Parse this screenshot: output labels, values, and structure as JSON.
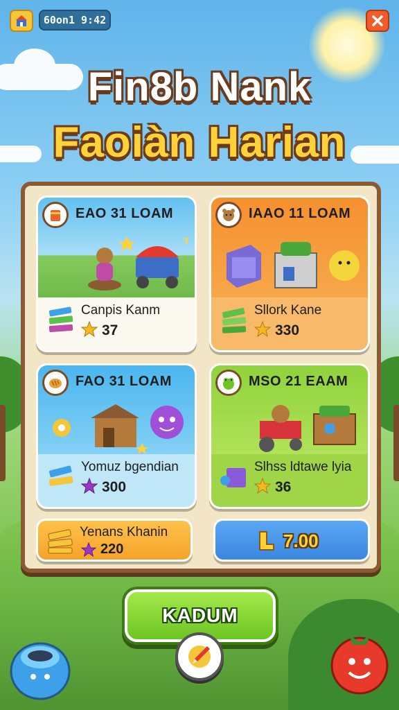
{
  "header": {
    "time": "60on1 9:42",
    "close_icon": "close-icon",
    "menu_icon": "house-icon"
  },
  "title": {
    "line1": "Fin8b Nank",
    "line2": "Faoiàn Harian"
  },
  "cards": [
    {
      "head": "EAO 31 LOAM",
      "name": "Canpis Kanm",
      "value": "37",
      "star_color": "#f5b820"
    },
    {
      "head": "IAAO 11 LOAM",
      "name": "Sllork Kane",
      "value": "330",
      "star_color": "#f5b820"
    },
    {
      "head": "FAO 31 LOAM",
      "name": "Yomuz bgendian",
      "value": "300",
      "star_color": "#9a38c8"
    },
    {
      "head": "MSO 21 EAAM",
      "name": "Slhss ldtawe lyia",
      "value": "36",
      "star_color": "#f5b820"
    }
  ],
  "bottom": {
    "left_name": "Yenans Khanin",
    "left_value": "220",
    "right_price": "7.00"
  },
  "action": {
    "label": "KADUM"
  },
  "colors": {
    "accent_green": "#6cc524",
    "board_border": "#8a5a33",
    "title_yellow": "#ffd23a",
    "close_red": "#f25b2a"
  }
}
